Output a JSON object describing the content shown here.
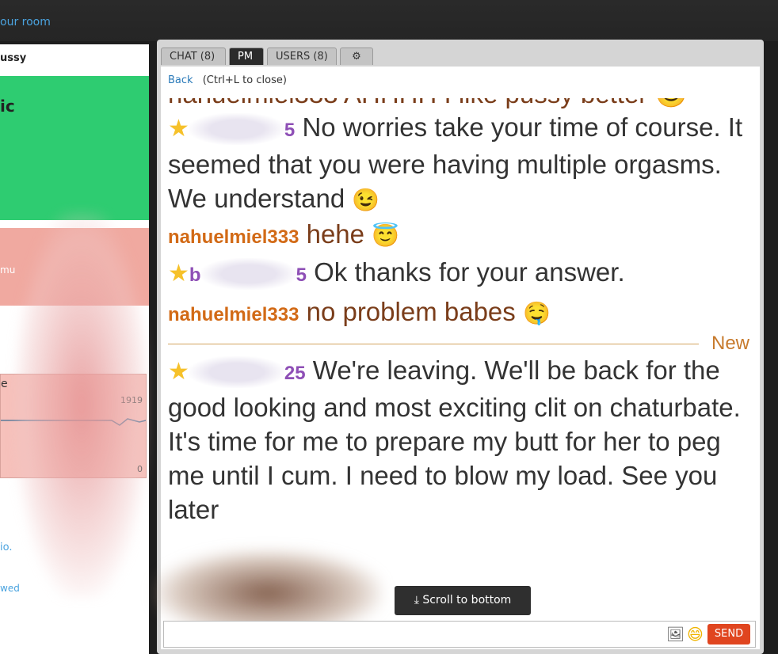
{
  "topbar": {
    "room_link": "our room"
  },
  "left_panel": {
    "title": "ussy",
    "green_text": "ic",
    "salmon_text": "mu",
    "graph": {
      "letter": "e",
      "max_label": "1919",
      "min_label": "0"
    },
    "link1": "io.",
    "link2": "wed"
  },
  "tabs": {
    "chat": "CHAT (8)",
    "pm": "PM",
    "users": "USERS (8)",
    "settings_icon": "gear-icon"
  },
  "pm": {
    "back": "Back",
    "hint": "(Ctrl+L to close)"
  },
  "messages": [
    {
      "user_suffix": "5",
      "text": "No worries take your time of course. It seemed that you were having multiple orgasms. We understand",
      "emoji": "😉"
    },
    {
      "user": "nahuelmiel333",
      "text": "hehe",
      "emoji": "😇"
    },
    {
      "user_prefix": "b",
      "user_suffix": "5",
      "text": "Ok thanks for your answer."
    },
    {
      "user": "nahuelmiel333",
      "text": "no problem babes",
      "emoji": "🤤"
    },
    {
      "user_suffix": "25",
      "text": "We're leaving. We'll be back for the good looking and most exciting clit on chaturbate. It's time for me to prepare my butt for her to peg me until I cum. I need to blow my load. See you later"
    }
  ],
  "new_label": "New",
  "scroll_button": "Scroll to bottom",
  "input": {
    "placeholder": "",
    "send_label": "SEND"
  }
}
